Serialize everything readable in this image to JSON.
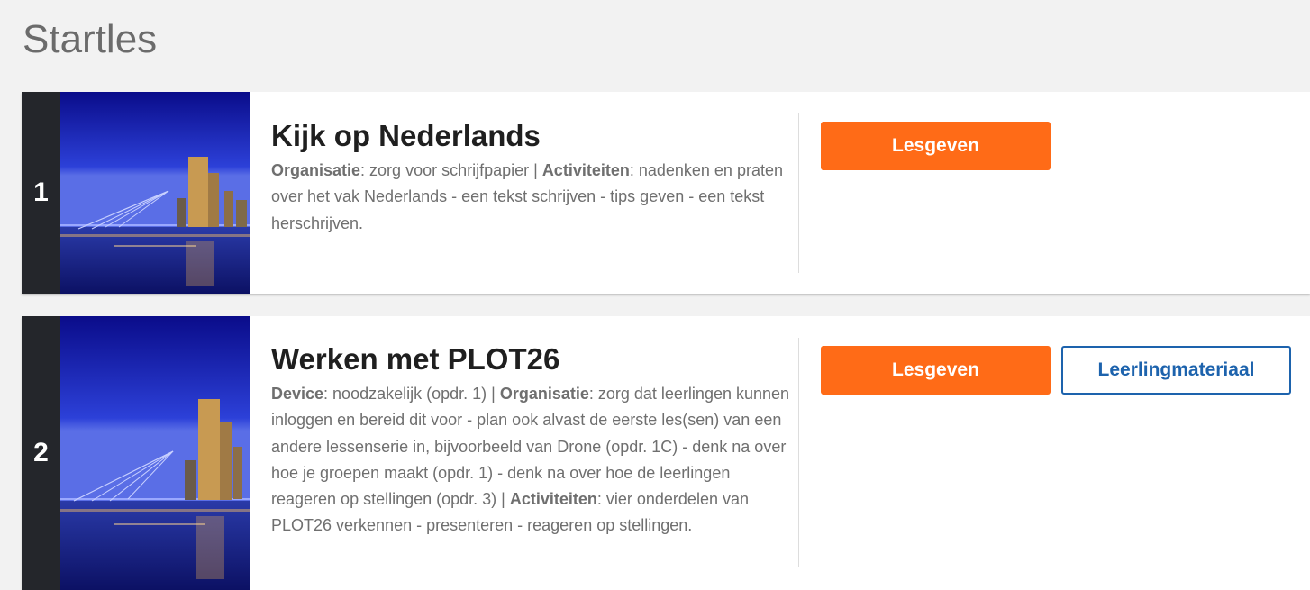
{
  "page": {
    "title": "Startles"
  },
  "lessons": [
    {
      "number": "1",
      "title": "Kijk op Nederlands",
      "description": [
        {
          "label": "Organisatie",
          "text": ": zorg voor schrijfpapier | "
        },
        {
          "label": "Activiteiten",
          "text": ": nadenken en praten over het vak Nederlands - een tekst schrijven - tips geven - een tekst herschrijven."
        }
      ],
      "buttons": {
        "primary": "Lesgeven"
      }
    },
    {
      "number": "2",
      "title": "Werken met PLOT26",
      "description": [
        {
          "label": "Device",
          "text": ": noodzakelijk (opdr. 1) | "
        },
        {
          "label": "Organisatie",
          "text": ": zorg dat leerlingen kunnen inloggen en bereid dit voor - plan ook alvast de eerste les(sen) van een andere lessenserie in, bijvoorbeeld van Drone (opdr. 1C) - denk na over hoe je groepen maakt (opdr. 1) - denk na over hoe de leerlingen reageren op stellingen (opdr. 3) | "
        },
        {
          "label": "Activiteiten",
          "text": ": vier onderdelen van PLOT26 verkennen - presenteren - reageren op stellingen."
        }
      ],
      "buttons": {
        "primary": "Lesgeven",
        "secondary": "Leerlingmateriaal"
      }
    }
  ],
  "colors": {
    "accent": "#ff6b17",
    "secondary": "#1d63ad",
    "number_bg": "#24262b",
    "page_bg": "#f2f2f2"
  },
  "icons": {
    "thumbnail": "rotterdam-skyline-image"
  }
}
